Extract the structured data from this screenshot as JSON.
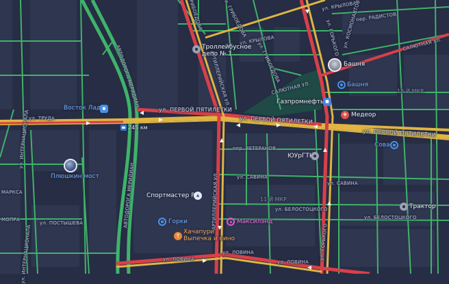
{
  "map": {
    "colors": {
      "background": "#262d44",
      "block": "#2f3650",
      "park": "#1f4a45",
      "traffic_free": "#3fb36a",
      "traffic_slow": "#e0b542",
      "traffic_jam": "#d8404a",
      "road_minor": "#3c4663"
    },
    "streets": {
      "pervoy_pyatiletki_left": "ул. ПЕРВОЙ ПЯТИЛЕТКИ",
      "pervoy_pyatiletki_mid": "ул. ПЕРВОЙ ПЯТИЛЕТКИ",
      "pervoy_pyatiletki_right": "ул. ПЕРВОЙ ПЯТИЛЕТКИ",
      "truda": "ул. ТРУДА",
      "meridian_north": "АВТОДОРОГА МЕРИДИАН",
      "meridian_south": "АВТОДОРОГА МЕРИДИАН",
      "internatsionala_top": "ул. ИНТЕРНАЦИОНАЛА",
      "internatsionala_bottom": "ул. ИНТЕРНАЦИОНАЛА",
      "artilleriyskaya_top": "АРТИЛЛЕРИЙСКАЯ УЛ.",
      "artilleriyskaya_bottom": "АРТИЛЛЕРИЙСКАЯ УЛ.",
      "gorkogo_top": "ул. ГОРЬКОГО",
      "gorkogo_bottom": "ул. ГОРЬКОГО",
      "krylova_top": "ул. КРЫЛОВА",
      "krylova_mid": "ул. КРЫЛОВА",
      "radistov": "пер. РАДИСТОВ",
      "salyutnaya_right": "САЛЮТНАЯ УЛ.",
      "salyutnaya_mid": "САЛЮТНАЯ УЛ.",
      "gribodeva_top": "ул. ГРИБОЕДОВА",
      "gribodeva_left": "ул. ГРИБОЕДОВА",
      "gribodeva_mid": "ул. ГРИБОЕДОВА",
      "kosmonavtov": "ул. КОСМОНАВТОВ",
      "veteranov": "пер. ВЕТЕРАНОВ",
      "savina_left": "ул. САВИНА",
      "savina_right": "ул. САВИНА",
      "belostotskogo_left": "ул. БЕЛОСТОЦКОГО",
      "belostotskogo_right": "ул. БЕЛОСТОЦКОГО",
      "postysheva": "ул. ПОСТЫШЕВА",
      "lovina_left": "ул. ЛОВИНА",
      "lovina_mid": "ул. ЛОВИНА",
      "lovina_right": "ул. ЛОВИНА",
      "marksa": "МАРКСА",
      "mopra": "МОПРА"
    },
    "districts": {
      "mkr13": "13-Й МКР.",
      "mkr11": "11-Й МКР."
    },
    "pois": {
      "trolleybus_depot": "Троллейбусное\nдепо № 1",
      "bashnya_photo": "Башня",
      "bashnya_shop": "Башня",
      "vostok_lada": "Восток Лада",
      "gazpromneft": "Газпромнефть",
      "medeor": "Медеор",
      "sova": "Сова",
      "yurgtk": "ЮУрГТК",
      "plyushkin_most": "Плюшкин мост",
      "sportmaster": "Спортмастер Pro",
      "gorki": "Горки",
      "maksilend": "Максилэнд",
      "khachapuri": "Хачапури\nВыпечка и вино",
      "traktor": "Трактор"
    },
    "distance_marker": "245 км"
  }
}
